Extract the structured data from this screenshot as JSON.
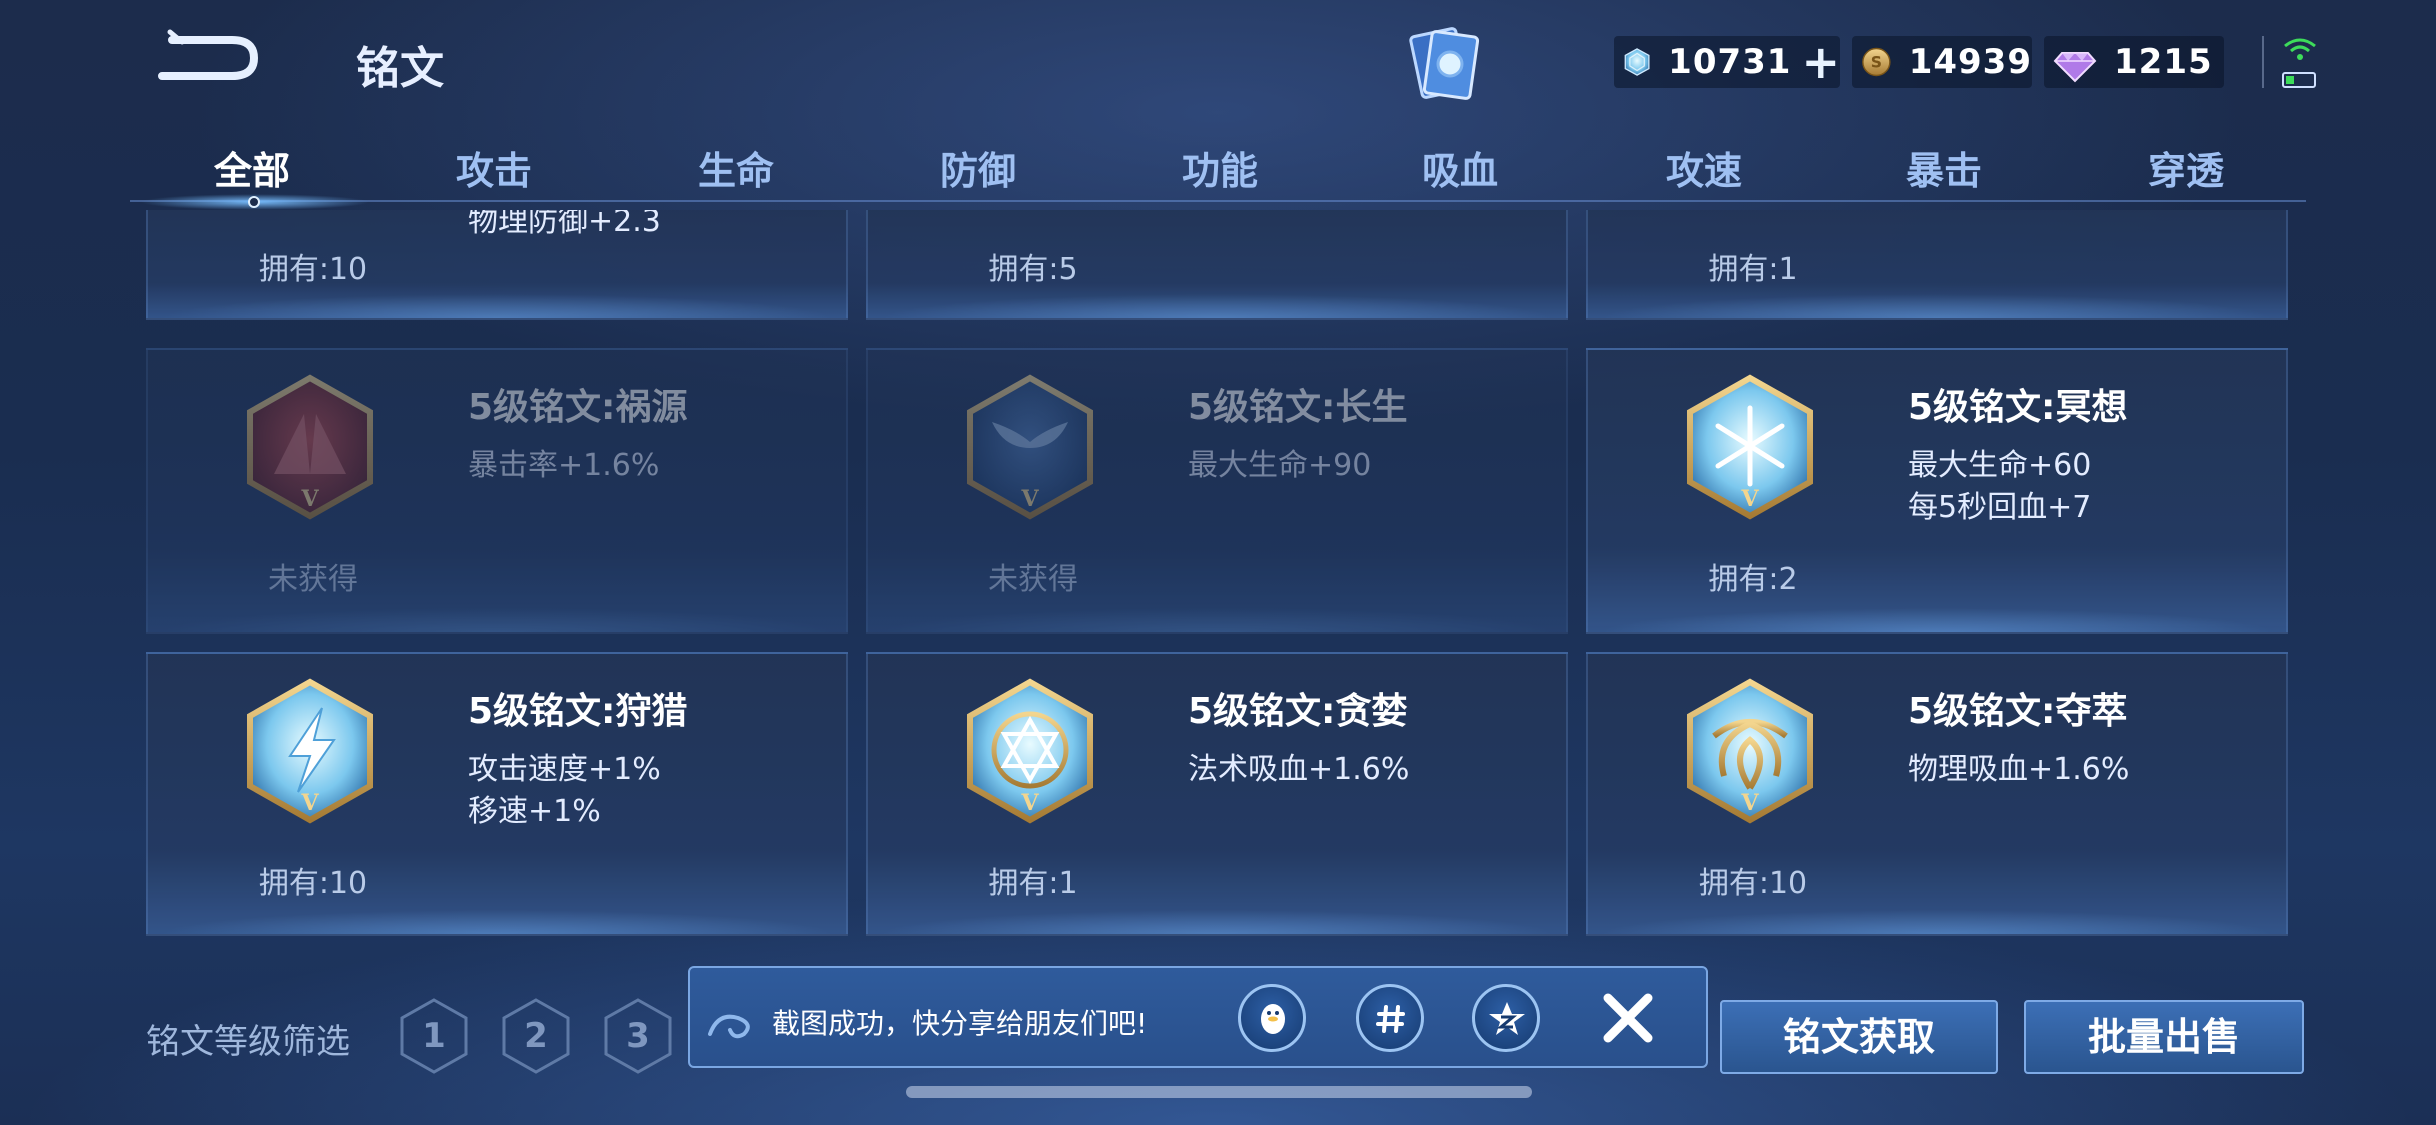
{
  "header": {
    "title": "铭文",
    "currencies": [
      {
        "name": "crystal-currency",
        "value": "10731",
        "has_plus": true
      },
      {
        "name": "gold-coin-currency",
        "value": "14939"
      },
      {
        "name": "diamond-currency",
        "value": "1215"
      }
    ],
    "plus_label": "+"
  },
  "tabs": [
    "全部",
    "攻击",
    "生命",
    "防御",
    "功能",
    "吸血",
    "攻速",
    "暴击",
    "穿透"
  ],
  "active_tab": "全部",
  "runes": {
    "row0": [
      {
        "stat1": "物理防御+2.3",
        "owned": "拥有:10"
      },
      {
        "owned": "拥有:5"
      },
      {
        "owned": "拥有:1"
      }
    ],
    "row1": [
      {
        "name": "5级铭文:祸源",
        "stat1": "暴击率+1.6%",
        "owned": "未获得",
        "locked": true,
        "icon": "crimson-wing-rune-icon"
      },
      {
        "name": "5级铭文:长生",
        "stat1": "最大生命+90",
        "owned": "未获得",
        "locked": true,
        "icon": "whale-tail-rune-icon"
      },
      {
        "name": "5级铭文:冥想",
        "stat1": "最大生命+60",
        "stat2": "每5秒回血+7",
        "owned": "拥有:2",
        "icon": "snowflake-rune-icon"
      }
    ],
    "row2": [
      {
        "name": "5级铭文:狩猎",
        "stat1": "攻击速度+1%",
        "stat2": "移速+1%",
        "owned": "拥有:10",
        "icon": "lightning-rune-icon"
      },
      {
        "name": "5级铭文:贪婪",
        "stat1": "法术吸血+1.6%",
        "owned": "拥有:1",
        "icon": "star-circle-rune-icon"
      },
      {
        "name": "5级铭文:夺萃",
        "stat1": "物理吸血+1.6%",
        "owned": "拥有:10",
        "icon": "knot-rune-icon"
      }
    ]
  },
  "filter": {
    "label": "铭文等级筛选",
    "levels": [
      "1",
      "2",
      "3"
    ]
  },
  "toast": {
    "text": "截图成功，快分享给朋友们吧!",
    "share_targets": [
      "qq",
      "wechat",
      "qzone"
    ]
  },
  "buttons": {
    "get_runes": "铭文获取",
    "batch_sell": "批量出售"
  },
  "colors": {
    "background": "#1c2c4c",
    "tab_active": "#ffffff",
    "tab_inactive": "#9fc0f2",
    "button": "#3c6fb6",
    "emblem_gold": "#c9a45a",
    "emblem_ice": "#8fd0f0"
  }
}
